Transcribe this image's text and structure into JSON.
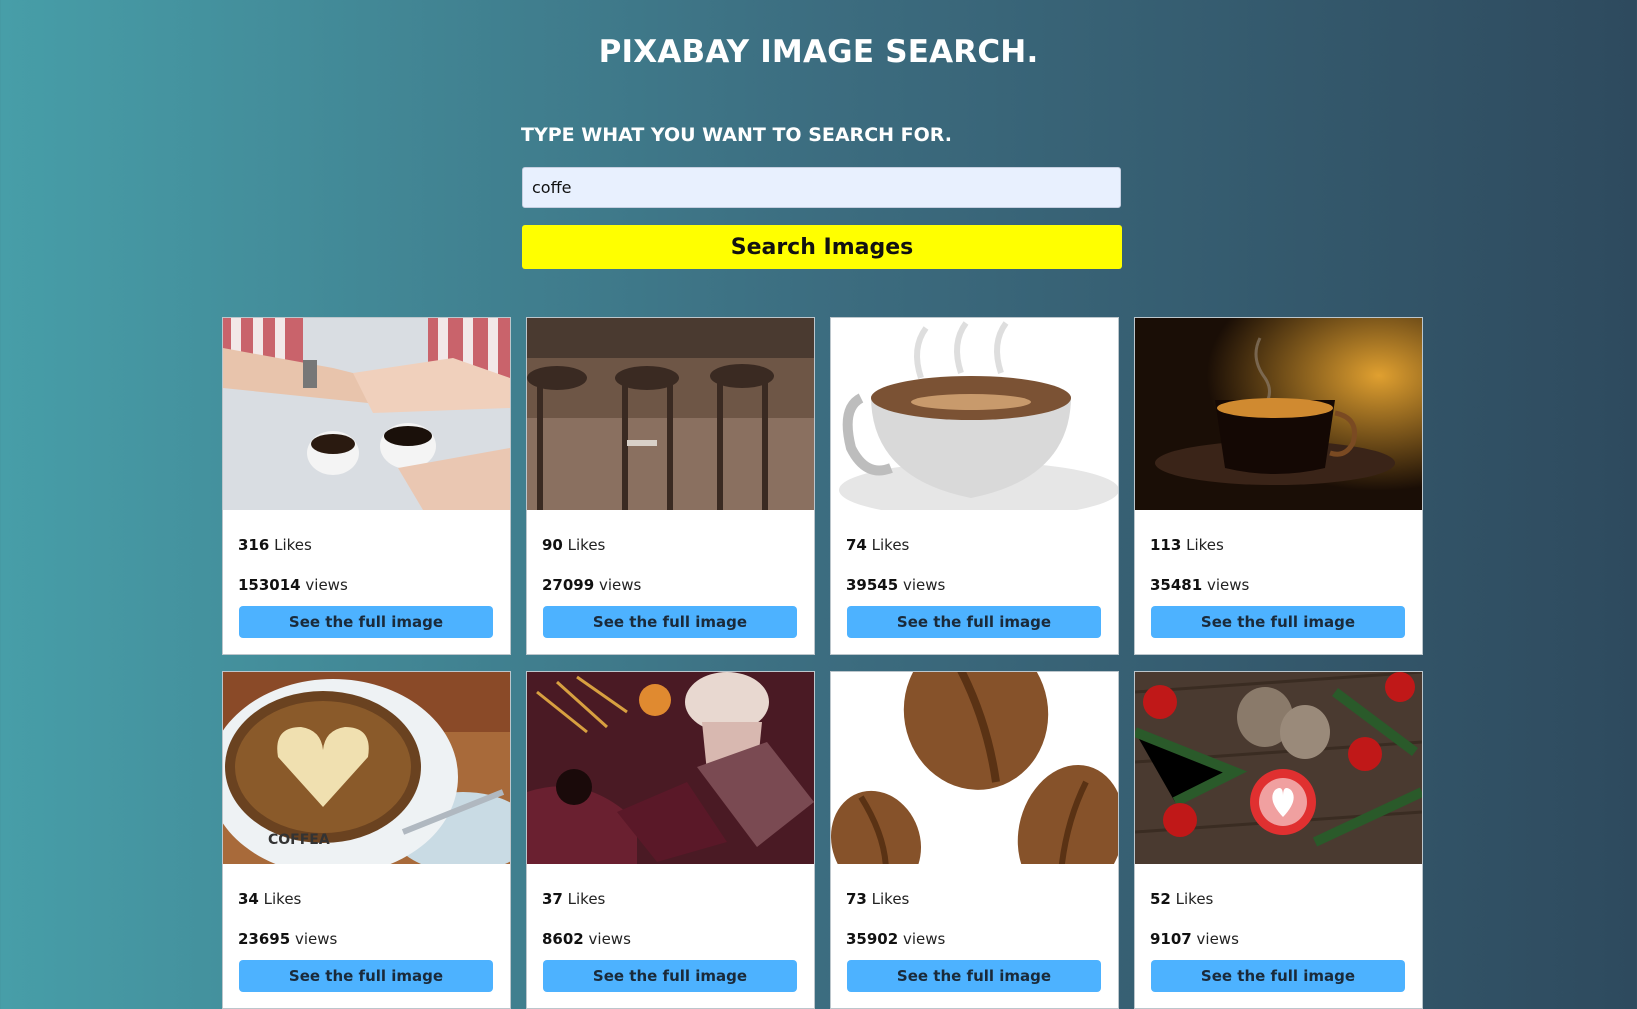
{
  "app": {
    "title": "PIXABAY IMAGE SEARCH."
  },
  "search": {
    "prompt": "TYPE WHAT YOU WANT TO SEARCH FOR.",
    "value": "coffe",
    "button_label": "Search Images"
  },
  "results": [
    {
      "likes": "316",
      "likes_label": "Likes",
      "views": "153014",
      "views_label": "views",
      "button_label": "See the full image",
      "thumb": "coffee-hands-image"
    },
    {
      "likes": "90",
      "likes_label": "Likes",
      "views": "27099",
      "views_label": "views",
      "button_label": "See the full image",
      "thumb": "bar-stools-image"
    },
    {
      "likes": "74",
      "likes_label": "Likes",
      "views": "39545",
      "views_label": "views",
      "button_label": "See the full image",
      "thumb": "coffee-cup-illustration"
    },
    {
      "likes": "113",
      "likes_label": "Likes",
      "views": "35481",
      "views_label": "views",
      "button_label": "See the full image",
      "thumb": "espresso-glass-image"
    },
    {
      "likes": "34",
      "likes_label": "Likes",
      "views": "23695",
      "views_label": "views",
      "button_label": "See the full image",
      "thumb": "latte-art-image"
    },
    {
      "likes": "37",
      "likes_label": "Likes",
      "views": "8602",
      "views_label": "views",
      "button_label": "See the full image",
      "thumb": "autumn-flatlay-image"
    },
    {
      "likes": "73",
      "likes_label": "Likes",
      "views": "35902",
      "views_label": "views",
      "button_label": "See the full image",
      "thumb": "coffee-beans-illustration"
    },
    {
      "likes": "52",
      "likes_label": "Likes",
      "views": "9107",
      "views_label": "views",
      "button_label": "See the full image",
      "thumb": "christmas-latte-image"
    }
  ]
}
